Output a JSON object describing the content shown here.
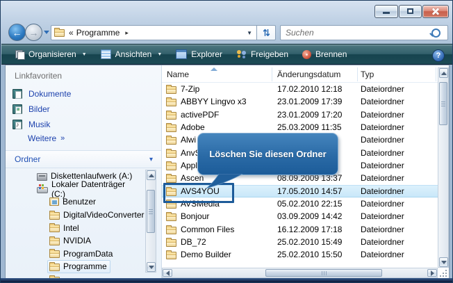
{
  "glyphs": {
    "back": "←",
    "forward": "→",
    "crumb_overflow": "«",
    "crumb_arrow": "▸",
    "dropdown": "▼",
    "refresh": "⇄",
    "caret": "▼",
    "help": "?",
    "more": "»",
    "collapse": "▾"
  },
  "address_bar": {
    "breadcrumb_segment": "Programme",
    "search_placeholder": "Suchen"
  },
  "toolbar": {
    "items": [
      {
        "label": "Organisieren",
        "icon": "organize",
        "dropdown": true
      },
      {
        "label": "Ansichten",
        "icon": "views",
        "dropdown": true
      },
      {
        "label": "Explorer",
        "icon": "explorer",
        "dropdown": false
      },
      {
        "label": "Freigeben",
        "icon": "share",
        "dropdown": false
      },
      {
        "label": "Brennen",
        "icon": "burn",
        "dropdown": false
      }
    ]
  },
  "sidebar": {
    "favorites_header": "Linkfavoriten",
    "favorites": [
      {
        "label": "Dokumente",
        "icon": "documents"
      },
      {
        "label": "Bilder",
        "icon": "pictures"
      },
      {
        "label": "Musik",
        "icon": "music"
      }
    ],
    "more_link": "Weitere",
    "folders_header": "Ordner",
    "tree": [
      {
        "label": "Diskettenlaufwerk (A:)",
        "icon": "floppy",
        "level": 0,
        "selected": false
      },
      {
        "label": "Lokaler Datenträger (C:)",
        "icon": "drive",
        "level": 0,
        "selected": false
      },
      {
        "label": "Benutzer",
        "icon": "users-folder",
        "level": 1,
        "selected": false
      },
      {
        "label": "DigitalVideoConverter",
        "icon": "folder",
        "level": 1,
        "selected": false
      },
      {
        "label": "Intel",
        "icon": "folder",
        "level": 1,
        "selected": false
      },
      {
        "label": "NVIDIA",
        "icon": "folder",
        "level": 1,
        "selected": false
      },
      {
        "label": "ProgramData",
        "icon": "folder",
        "level": 1,
        "selected": false
      },
      {
        "label": "Programme",
        "icon": "folder",
        "level": 1,
        "selected": true
      }
    ]
  },
  "list": {
    "columns": [
      "Name",
      "Änderungsdatum",
      "Typ"
    ],
    "rows": [
      {
        "name": "7-Zip",
        "date": "17.02.2010 12:18",
        "type": "Dateiordner",
        "selected": false
      },
      {
        "name": "ABBYY Lingvo x3",
        "date": "23.01.2009 17:39",
        "type": "Dateiordner",
        "selected": false
      },
      {
        "name": "activePDF",
        "date": "23.01.2009 17:20",
        "type": "Dateiordner",
        "selected": false
      },
      {
        "name": "Adobe",
        "date": "25.03.2009 11:35",
        "type": "Dateiordner",
        "selected": false
      },
      {
        "name": "Alwi",
        "date": "",
        "type": "Dateiordner",
        "selected": false
      },
      {
        "name": "AnvS",
        "date": "",
        "type": "Dateiordner",
        "selected": false
      },
      {
        "name": "Appl",
        "date": "",
        "type": "Dateiordner",
        "selected": false
      },
      {
        "name": "Ascen",
        "date": "08.09.2009 13:37",
        "type": "Dateiordner",
        "selected": false
      },
      {
        "name": "AVS4YOU",
        "date": "17.05.2010 14:57",
        "type": "Dateiordner",
        "selected": true
      },
      {
        "name": "AVSMedia",
        "date": "05.02.2010 22:15",
        "type": "Dateiordner",
        "selected": false
      },
      {
        "name": "Bonjour",
        "date": "03.09.2009 14:42",
        "type": "Dateiordner",
        "selected": false
      },
      {
        "name": "Common Files",
        "date": "16.12.2009 17:18",
        "type": "Dateiordner",
        "selected": false
      },
      {
        "name": "DB_72",
        "date": "25.02.2010 15:49",
        "type": "Dateiordner",
        "selected": false
      },
      {
        "name": "Demo Builder",
        "date": "25.02.2010 15:50",
        "type": "Dateiordner",
        "selected": false
      }
    ]
  },
  "callout": {
    "text": "Löschen Sie diesen Ordner"
  },
  "colors": {
    "callout_top": "#4585bd",
    "callout_bottom": "#1c5c99",
    "annotation_border": "#1d5b99",
    "selection_bg": "#cfe9fb",
    "toolbar_teal": "#2d5a64",
    "link_blue": "#1c41ad"
  }
}
